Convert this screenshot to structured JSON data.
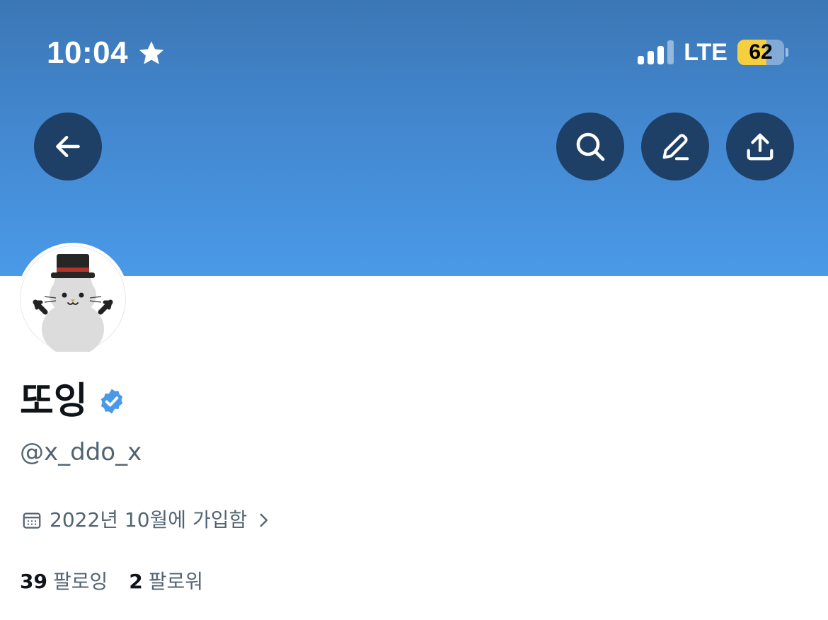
{
  "status_bar": {
    "time": "10:04",
    "network": "LTE",
    "battery_level": "62",
    "battery_fraction": 0.62,
    "signal_bars_active": 3,
    "signal_bars_total": 4
  },
  "header": {
    "back_icon": "arrow-left-icon",
    "actions": [
      "search-icon",
      "edit-icon",
      "share-icon"
    ],
    "banner_color_top": "#3b77b5",
    "banner_color_bottom": "#4a9ae8",
    "button_color": "#1e3f66"
  },
  "profile": {
    "display_name": "또잉",
    "handle": "@x_ddo_x",
    "verified_color": "#4a99e9",
    "joined": "2022년 10월에 가입함",
    "following_count": "39",
    "following_label": "팔로잉",
    "followers_count": "2",
    "followers_label": "팔로워"
  }
}
